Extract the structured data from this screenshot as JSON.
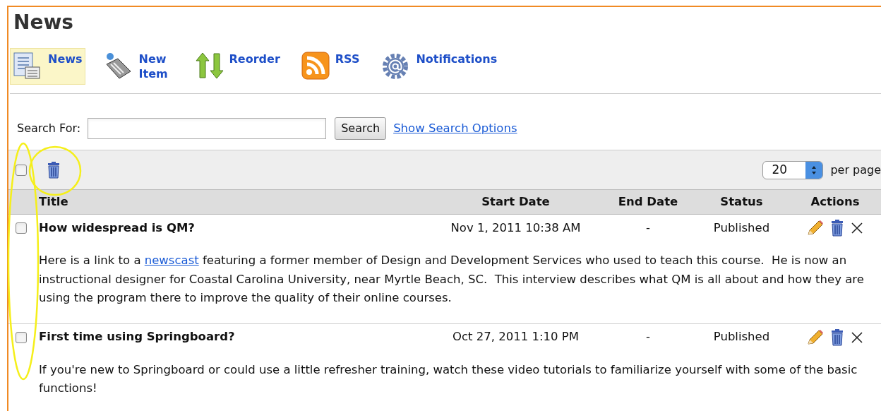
{
  "page_title": "News",
  "toolbar": [
    {
      "label": "News",
      "selected": true,
      "kind": "list"
    },
    {
      "label": "New Item",
      "selected": false,
      "kind": "new"
    },
    {
      "label": "Reorder",
      "selected": false,
      "kind": "reorder"
    },
    {
      "label": "RSS",
      "selected": false,
      "kind": "rss"
    },
    {
      "label": "Notifications",
      "selected": false,
      "kind": "notify"
    }
  ],
  "search": {
    "label": "Search For:",
    "button": "Search",
    "options_link": "Show Search Options"
  },
  "bulk_bar": {
    "select_all_checked": false,
    "page_size": "20",
    "per_page_label": "per page"
  },
  "table": {
    "columns": [
      "Title",
      "Start Date",
      "End Date",
      "Status",
      "Actions"
    ],
    "rows": [
      {
        "checked": false,
        "title": "How widespread is QM?",
        "start": "Nov 1, 2011 10:38 AM",
        "end": "-",
        "status": "Published",
        "description": [
          {
            "kind": "text",
            "text": "Here is a link to a "
          },
          {
            "kind": "link",
            "text": "newscast"
          },
          {
            "kind": "text",
            "text": " featuring a former member of Design and Development Services who used to teach this course.  He is now an instructional designer for Coastal Carolina University, near Myrtle Beach, SC.  This interview describes what QM is all about and how they are using the program there to improve the quality of their online courses."
          }
        ]
      },
      {
        "checked": false,
        "title": "First time using Springboard?",
        "start": "Oct 27, 2011 1:10 PM",
        "end": "-",
        "status": "Published",
        "description": [
          {
            "kind": "text",
            "text": "If you're new to Springboard or could use a little refresher training, watch these video tutorials to familiarize yourself with some of the basic functions!"
          }
        ]
      }
    ]
  }
}
